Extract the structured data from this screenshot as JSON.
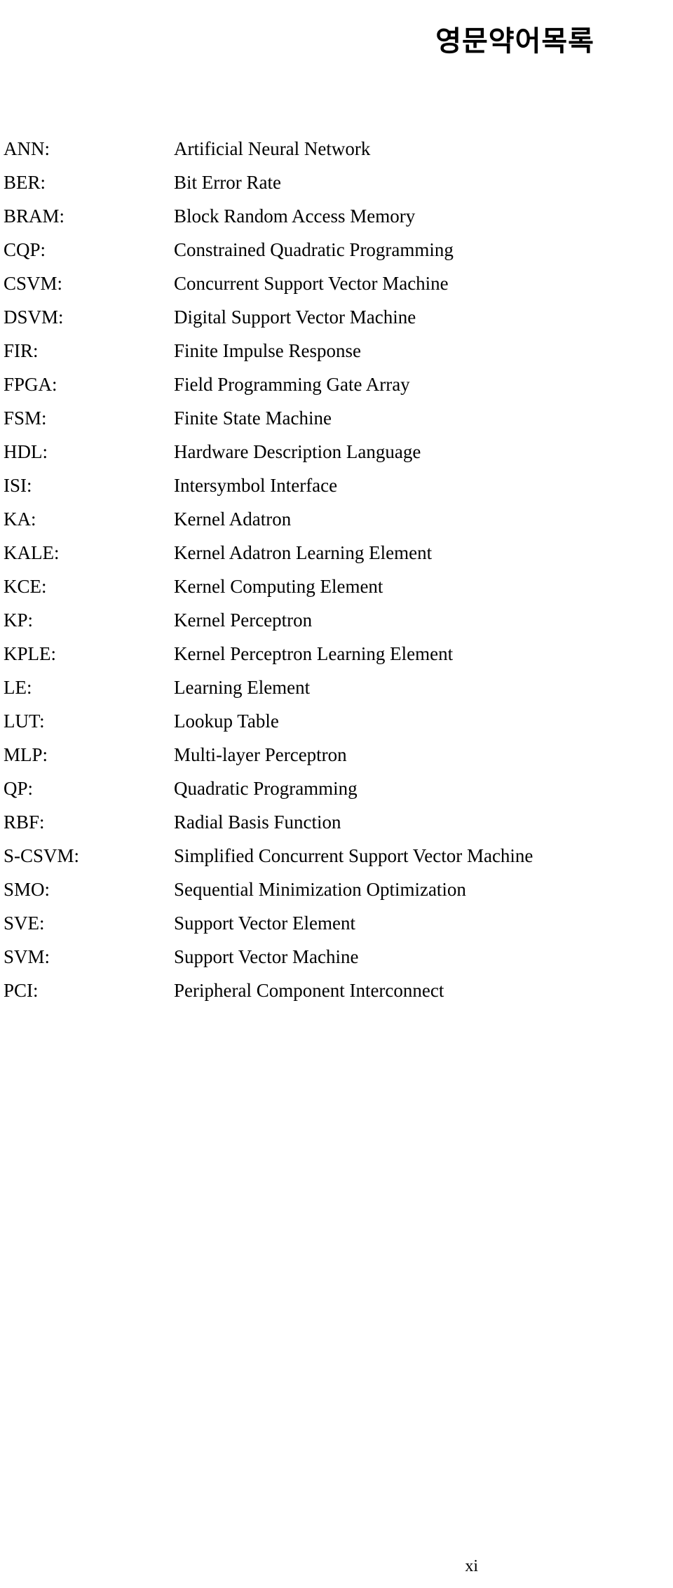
{
  "document": {
    "title": "영문약어목록",
    "page_number": "xi"
  },
  "abbreviations": [
    {
      "term": "ANN:",
      "definition": "Artificial Neural Network"
    },
    {
      "term": "BER:",
      "definition": "Bit Error Rate"
    },
    {
      "term": "BRAM:",
      "definition": "Block Random Access Memory"
    },
    {
      "term": "CQP:",
      "definition": "Constrained Quadratic Programming"
    },
    {
      "term": "CSVM:",
      "definition": "Concurrent Support Vector Machine"
    },
    {
      "term": "DSVM:",
      "definition": "Digital Support Vector Machine"
    },
    {
      "term": "FIR:",
      "definition": "Finite Impulse Response"
    },
    {
      "term": "FPGA:",
      "definition": "Field Programming Gate Array"
    },
    {
      "term": "FSM:",
      "definition": "Finite State Machine"
    },
    {
      "term": "HDL:",
      "definition": "Hardware Description Language"
    },
    {
      "term": "ISI:",
      "definition": "Intersymbol Interface"
    },
    {
      "term": "KA:",
      "definition": "Kernel Adatron"
    },
    {
      "term": "KALE:",
      "definition": "Kernel Adatron Learning Element"
    },
    {
      "term": "KCE:",
      "definition": "Kernel Computing Element"
    },
    {
      "term": "KP:",
      "definition": "Kernel Perceptron"
    },
    {
      "term": "KPLE:",
      "definition": "Kernel Perceptron Learning Element"
    },
    {
      "term": "LE:",
      "definition": "Learning Element"
    },
    {
      "term": "LUT:",
      "definition": "Lookup Table"
    },
    {
      "term": "MLP:",
      "definition": "Multi-layer Perceptron"
    },
    {
      "term": "QP:",
      "definition": "Quadratic Programming"
    },
    {
      "term": "RBF:",
      "definition": "Radial Basis Function"
    },
    {
      "term": "S-CSVM:",
      "definition": "Simplified Concurrent Support Vector Machine"
    },
    {
      "term": "SMO:",
      "definition": "Sequential Minimization Optimization"
    },
    {
      "term": "SVE:",
      "definition": "Support Vector Element"
    },
    {
      "term": "SVM:",
      "definition": "Support Vector Machine"
    },
    {
      "term": "PCI:",
      "definition": "Peripheral Component Interconnect"
    }
  ]
}
